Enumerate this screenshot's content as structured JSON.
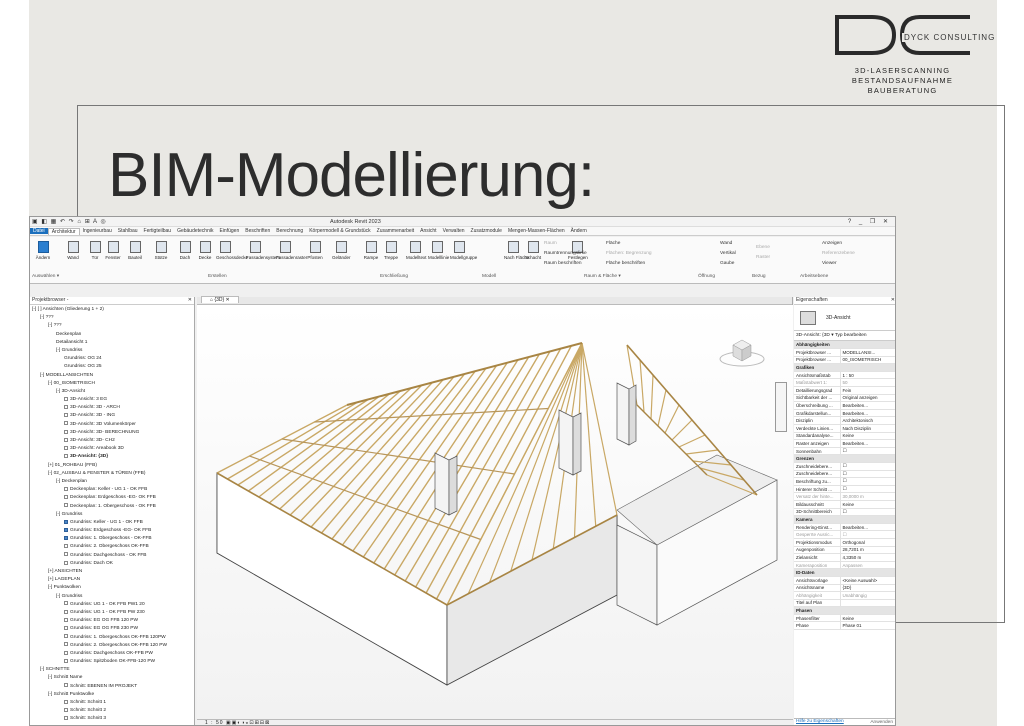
{
  "slide": {
    "title": "BIM-Modellierung:",
    "logo": {
      "company_name": "DYCK CONSULTING",
      "taglines": [
        "3D-LASERSCANNING",
        "BESTANDSAUFNAHME",
        "BAUBERATUNG"
      ]
    }
  },
  "app": {
    "title": "Autodesk Revit 2023",
    "tabs": [
      "Datei",
      "Architektur",
      "Ingenieurbau",
      "Stahlbau",
      "Fertigteilbau",
      "Gebäudetechnik",
      "Einfügen",
      "Beschriften",
      "Berechnung",
      "Körpermodell & Grundstück",
      "Zusammenarbeit",
      "Ansicht",
      "Verwalten",
      "Zusatzmodule",
      "Mengen-Massen-Flächen",
      "Ändern"
    ],
    "active_tab": "Architektur",
    "ribbon": {
      "buttons": [
        "Ändern",
        "Wand",
        "Tür",
        "Fenster",
        "Bauteil",
        "Stütze",
        "Dach",
        "Decke",
        "Geschossdecke",
        "Fassadensystem",
        "Fassadenraster",
        "Pfosten",
        "Geländer",
        "Rampe",
        "Treppe",
        "Modelltext",
        "Modelllinie",
        "Modellgruppe",
        "Nach Fläche",
        "Schacht",
        "Festlegen"
      ],
      "raum_group": [
        "Raum",
        "Raumtrennungslinie",
        "Raum beschriften",
        "Fläche",
        "Flächen: Begrenzung",
        "Fläche beschriften"
      ],
      "oeffnung_small": [
        "Wand",
        "Vertikal",
        "Gaube"
      ],
      "bezug_small": [
        "Ebene",
        "Raster"
      ],
      "ap_small": [
        "Anzeigen",
        "Referenzebene",
        "Viewer"
      ],
      "panels": [
        "Auswählen ▾",
        "Erstellen",
        "Erschließung",
        "Modell",
        "Raum & Fläche ▾",
        "Öffnung",
        "Bezug",
        "Arbeitsebene"
      ]
    },
    "project_browser": {
      "header": "Projektbrowser -",
      "items": [
        {
          "text": "[-] [ ] Ansichten (Gliederung 1 + 2)",
          "indent": 0,
          "bold": false
        },
        {
          "text": "[-] ???",
          "indent": 1
        },
        {
          "text": "[-] ???",
          "indent": 2
        },
        {
          "text": "Deckenplan",
          "indent": 3
        },
        {
          "text": "Detailansicht 1",
          "indent": 3
        },
        {
          "text": "[-] Grundriss",
          "indent": 3
        },
        {
          "text": "Grundriss: OG 24",
          "indent": 4
        },
        {
          "text": "Grundriss: OG 25",
          "indent": 4
        },
        {
          "text": "[-] MODELLANSICHTEN",
          "indent": 1
        },
        {
          "text": "[-] 00_ISOMETRISCH",
          "indent": 2
        },
        {
          "text": "[-] 3D-Ansicht",
          "indent": 3
        },
        {
          "text": "3D-Ansicht: 3 EG",
          "indent": 4,
          "box": true
        },
        {
          "text": "3D-Ansicht: 3D - ARCH",
          "indent": 4,
          "box": true
        },
        {
          "text": "3D-Ansicht: 3D - ING",
          "indent": 4,
          "box": true
        },
        {
          "text": "3D-Ansicht: 3D Volumenkörper",
          "indent": 4,
          "box": true
        },
        {
          "text": "3D-Ansicht: 3D- BERECHNUNG",
          "indent": 4,
          "box": true
        },
        {
          "text": "3D-Ansicht: 3D- CH2",
          "indent": 4,
          "box": true
        },
        {
          "text": "3D-Ansicht: Areabook 3D",
          "indent": 4,
          "box": true
        },
        {
          "text": "3D-Ansicht: {3D}",
          "indent": 4,
          "box": true,
          "bold": true
        },
        {
          "text": "[+] 01_ROHBAU (FFB)",
          "indent": 2
        },
        {
          "text": "[-] 02_AUSBAU & FENSTER & TÜREN (FFB)",
          "indent": 2
        },
        {
          "text": "[-] Deckenplan",
          "indent": 3
        },
        {
          "text": "Deckenplan: Keller - UG 1 - OK FFB",
          "indent": 4,
          "box": true
        },
        {
          "text": "Deckenplan: Erdgeschoss -EG- OK FFB",
          "indent": 4,
          "box": true
        },
        {
          "text": "Deckenplan: 1. Obergeschoss - OK FFB",
          "indent": 4,
          "box": true
        },
        {
          "text": "[-] Grundriss",
          "indent": 3
        },
        {
          "text": "Grundriss: Keller - UG 1 - OK FFB",
          "indent": 4,
          "box": true,
          "blue": true
        },
        {
          "text": "Grundriss: Erdgeschoss -EG- OK FFB",
          "indent": 4,
          "box": true,
          "blue": true
        },
        {
          "text": "Grundriss: 1. Obergeschoss - OK-FFB",
          "indent": 4,
          "box": true,
          "blue": true
        },
        {
          "text": "Grundriss: 2. Obergeschoss OK-FFB",
          "indent": 4,
          "box": true
        },
        {
          "text": "Grundriss: Dachgeschoss - OK FFB",
          "indent": 4,
          "box": true
        },
        {
          "text": "Grundriss: Dach OK",
          "indent": 4,
          "box": true
        },
        {
          "text": "[+] ANSICHTEN",
          "indent": 2
        },
        {
          "text": "[+] LAGEPLAN",
          "indent": 2
        },
        {
          "text": "[-] Punktwolken",
          "indent": 2
        },
        {
          "text": "[-] Grundriss",
          "indent": 3
        },
        {
          "text": "Grundriss: UG 1 - OK FFB PW1 20",
          "indent": 4,
          "box": true
        },
        {
          "text": "Grundriss: UG 1 - OK FFB PW 230",
          "indent": 4,
          "box": true
        },
        {
          "text": "Grundriss: EG OG FFB 120 PW",
          "indent": 4,
          "box": true
        },
        {
          "text": "Grundriss: EG OG FFB 230 PW",
          "indent": 4,
          "box": true
        },
        {
          "text": "Grundriss: 1. Obergeschoss OK-FFB 120PW",
          "indent": 4,
          "box": true
        },
        {
          "text": "Grundriss: 2. Obergeschoss OK-FFB 120 PW",
          "indent": 4,
          "box": true
        },
        {
          "text": "Grundriss: Dachgeschoss OK-FFB PW",
          "indent": 4,
          "box": true
        },
        {
          "text": "Grundriss: Spitzboden OK-FFB-120 PW",
          "indent": 4,
          "box": true
        },
        {
          "text": "[-] SCHNITTE",
          "indent": 1
        },
        {
          "text": "[-] Schnitt Name",
          "indent": 2
        },
        {
          "text": "Schnitt: EBENEN IM PROJEKT",
          "indent": 4,
          "box": true
        },
        {
          "text": "[-] Schnitt Punktwolke",
          "indent": 2
        },
        {
          "text": "Schnitt: Schnitt 1",
          "indent": 4,
          "box": true
        },
        {
          "text": "Schnitt: Schnitt 2",
          "indent": 4,
          "box": true
        },
        {
          "text": "Schnitt: Schnitt 3",
          "indent": 4,
          "box": true
        }
      ]
    },
    "view": {
      "tab_label": "{3D}",
      "scale": "1 : 50"
    },
    "properties": {
      "header": "Eigenschaften",
      "type_name": "3D-Ansicht",
      "selector": "3D-Ansicht: {3D  ▾   Typ bearbeiten",
      "rows": [
        {
          "group": "Abhängigkeiten"
        },
        {
          "k": "Projektbrowser ...",
          "v": "MODELLANSI..."
        },
        {
          "k": "Projektbrowser ...",
          "v": "00_ISOMETRISCH"
        },
        {
          "group": "Grafiken"
        },
        {
          "k": "Ansichtsmaßstab",
          "v": "1 : 50"
        },
        {
          "k": "Maßstabwert 1:",
          "v": "50",
          "dim": true
        },
        {
          "k": "Detaillierungsgrad",
          "v": "Fein"
        },
        {
          "k": "Sichtbarkeit der ...",
          "v": "Original anzeigen"
        },
        {
          "k": "Überschreibung ...",
          "v": "Bearbeiten..."
        },
        {
          "k": "Grafikdarstellun...",
          "v": "Bearbeiten..."
        },
        {
          "k": "Disziplin",
          "v": "Architektonisch"
        },
        {
          "k": "Verdeckte Linien...",
          "v": "Nach Disziplin"
        },
        {
          "k": "Standardanalyse...",
          "v": "Keine"
        },
        {
          "k": "Raster anzeigen",
          "v": "Bearbeiten..."
        },
        {
          "k": "Sonnenbahn",
          "v": "☐"
        },
        {
          "group": "Grenzen"
        },
        {
          "k": "Zuschneidebere...",
          "v": "☐"
        },
        {
          "k": "Zuschneidebere...",
          "v": "☐"
        },
        {
          "k": "Beschriftung zu...",
          "v": "☐"
        },
        {
          "k": "Hinterer Schnitt ...",
          "v": "☐"
        },
        {
          "k": "Versatz der hinte...",
          "v": "30,0000 m",
          "dim": true
        },
        {
          "k": "Bildausschnitt",
          "v": "Keine"
        },
        {
          "k": "3D-Schnittbereich",
          "v": "☐"
        },
        {
          "group": "Kamera"
        },
        {
          "k": "Rendering-Einst...",
          "v": "Bearbeiten..."
        },
        {
          "k": "Gesperrte Ausric...",
          "v": "☐",
          "dim": true
        },
        {
          "k": "Projektionsmodus",
          "v": "Orthogonal"
        },
        {
          "k": "Augenposition",
          "v": "28,7201 m"
        },
        {
          "k": "Zielansicht",
          "v": "4,3350 m"
        },
        {
          "k": "Kameraposition",
          "v": "Anpassen",
          "dim": true
        },
        {
          "group": "ID-Daten"
        },
        {
          "k": "Ansichtsvorlage",
          "v": "<Keine Auswahl>"
        },
        {
          "k": "Ansichtsname",
          "v": "{3D}"
        },
        {
          "k": "Abhängigkeit",
          "v": "Unabhängig",
          "dim": true
        },
        {
          "k": "Titel auf Plan",
          "v": ""
        },
        {
          "group": "Phasen"
        },
        {
          "k": "Phasenfilter",
          "v": "Keine"
        },
        {
          "k": "Phase",
          "v": "Phase 01"
        }
      ],
      "help_link": "Hilfe zu Eigenschaften",
      "apply": "Anwenden"
    }
  }
}
